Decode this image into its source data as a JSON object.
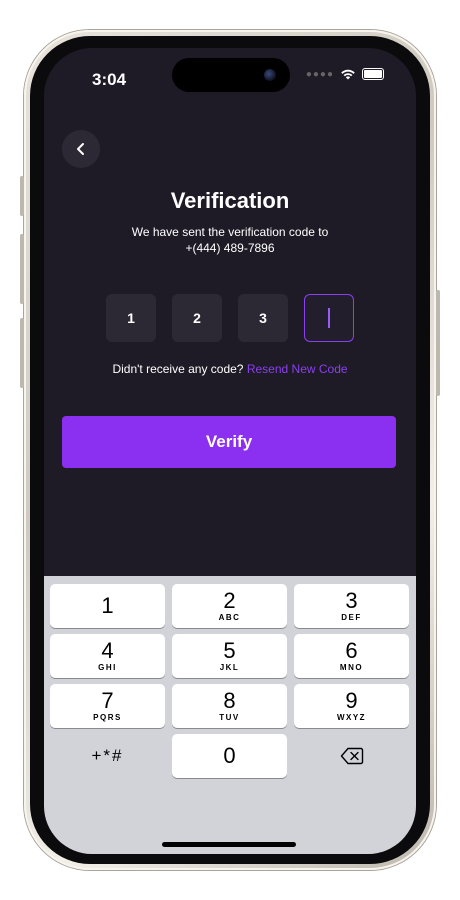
{
  "status_bar": {
    "time": "3:04"
  },
  "screen": {
    "title": "Verification",
    "subtitle_line1": "We have sent the verification code to",
    "subtitle_line2": "+(444) 489-7896",
    "code_digits": [
      "1",
      "2",
      "3",
      ""
    ],
    "resend_prompt": "Didn't receive any code?",
    "resend_link": "Resend New Code",
    "verify_label": "Verify",
    "accent_color": "#8b2ff0"
  },
  "keyboard": {
    "keys": [
      {
        "digit": "1",
        "letters": ""
      },
      {
        "digit": "2",
        "letters": "ABC"
      },
      {
        "digit": "3",
        "letters": "DEF"
      },
      {
        "digit": "4",
        "letters": "GHI"
      },
      {
        "digit": "5",
        "letters": "JKL"
      },
      {
        "digit": "6",
        "letters": "MNO"
      },
      {
        "digit": "7",
        "letters": "PQRS"
      },
      {
        "digit": "8",
        "letters": "TUV"
      },
      {
        "digit": "9",
        "letters": "WXYZ"
      },
      {
        "digit": "0",
        "letters": ""
      }
    ],
    "symbols_label": "+*#",
    "delete_icon": "backspace-icon"
  }
}
